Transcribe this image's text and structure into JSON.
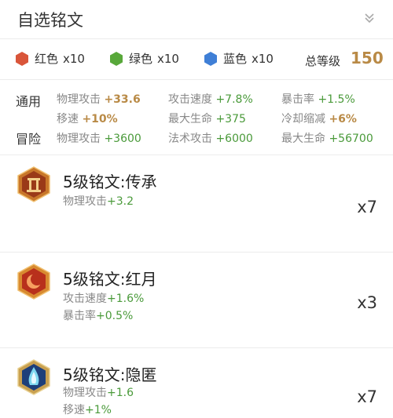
{
  "header": {
    "title": "自选铭文"
  },
  "colors": [
    {
      "label": "红色",
      "count": "x10",
      "color": "#d9553a"
    },
    {
      "label": "绿色",
      "count": "x10",
      "color": "#58a83a"
    },
    {
      "label": "蓝色",
      "count": "x10",
      "color": "#3f7fd6"
    }
  ],
  "total_level": {
    "label": "总等级",
    "value": "150"
  },
  "stats": {
    "general_label": "通用",
    "adventure_label": "冒险",
    "general": [
      {
        "name": "物理攻击",
        "value": "+33.6"
      },
      {
        "name": "攻击速度",
        "value": "+7.8%"
      },
      {
        "name": "暴击率",
        "value": "+1.5%"
      },
      {
        "name": "移速",
        "value": "+10%"
      },
      {
        "name": "最大生命",
        "value": "+375"
      },
      {
        "name": "冷却缩减",
        "value": "+6%"
      }
    ],
    "adventure": [
      {
        "name": "物理攻击",
        "value": "+3600"
      },
      {
        "name": "法术攻击",
        "value": "+6000"
      },
      {
        "name": "最大生命",
        "value": "+56700"
      }
    ]
  },
  "inscriptions": [
    {
      "name": "5级铭文:传承",
      "icon": "inheritance-rune-icon",
      "effects": [
        {
          "name": "物理攻击",
          "value": "+3.2"
        }
      ],
      "qty": "x7"
    },
    {
      "name": "5级铭文:红月",
      "icon": "red-moon-rune-icon",
      "effects": [
        {
          "name": "攻击速度",
          "value": "+1.6%"
        },
        {
          "name": "暴击率",
          "value": "+0.5%"
        }
      ],
      "qty": "x3"
    },
    {
      "name": "5级铭文:隐匿",
      "icon": "stealth-rune-icon",
      "effects": [
        {
          "name": "物理攻击",
          "value": "+1.6"
        },
        {
          "name": "移速",
          "value": "+1%"
        }
      ],
      "qty": "x7"
    }
  ]
}
